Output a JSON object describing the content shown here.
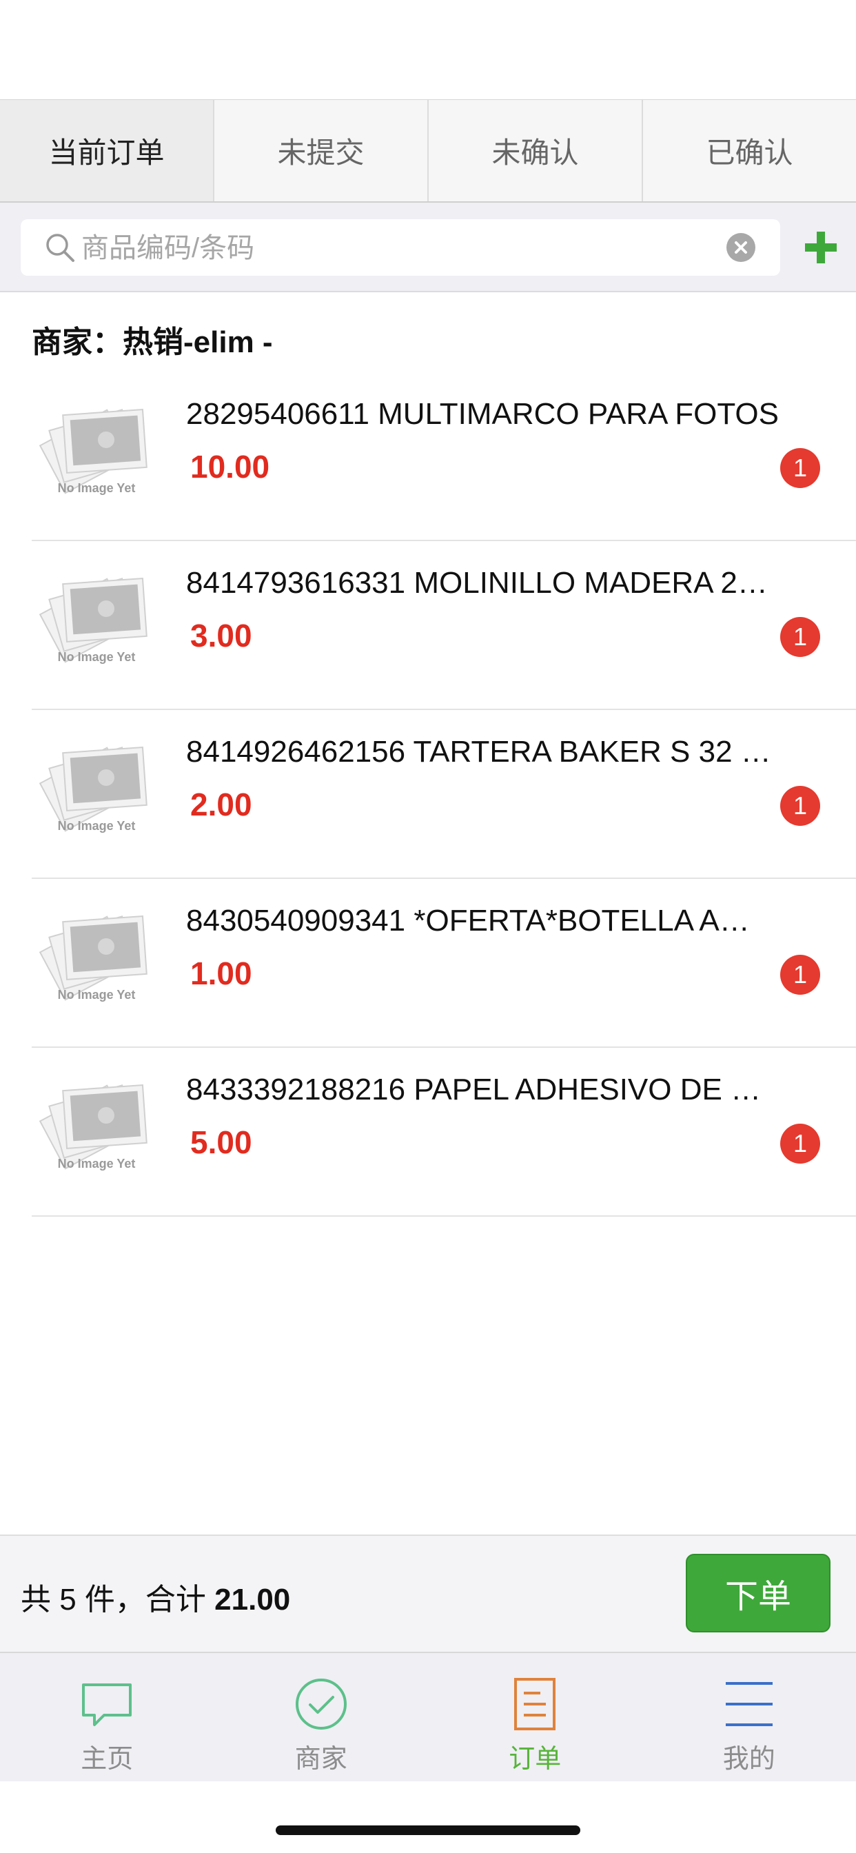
{
  "tabs": [
    {
      "label": "当前订单",
      "active": true
    },
    {
      "label": "未提交",
      "active": false
    },
    {
      "label": "未确认",
      "active": false
    },
    {
      "label": "已确认",
      "active": false
    }
  ],
  "search": {
    "placeholder": "商品编码/条码",
    "value": ""
  },
  "merchant": {
    "label": "商家：热销-elim -"
  },
  "items": [
    {
      "name": "28295406611 MULTIMARCO PARA FOTOS",
      "price": "10.00",
      "qty": "1",
      "thumb_text": "No Image Yet"
    },
    {
      "name": "8414793616331 MOLINILLO MADERA 2…",
      "price": "3.00",
      "qty": "1",
      "thumb_text": "No Image Yet"
    },
    {
      "name": "8414926462156 TARTERA BAKER S 32 …",
      "price": "2.00",
      "qty": "1",
      "thumb_text": "No Image Yet"
    },
    {
      "name": "8430540909341 *OFERTA*BOTELLA A…",
      "price": "1.00",
      "qty": "1",
      "thumb_text": "No Image Yet"
    },
    {
      "name": "8433392188216 PAPEL ADHESIVO DE …",
      "price": "5.00",
      "qty": "1",
      "thumb_text": "No Image Yet"
    }
  ],
  "summary": {
    "prefix": "共 5 件，合计 ",
    "total": "21.00",
    "submit_label": "下单"
  },
  "nav": [
    {
      "label": "主页",
      "icon": "chat-bubble-icon",
      "active": false
    },
    {
      "label": "商家",
      "icon": "check-circle-icon",
      "active": false
    },
    {
      "label": "订单",
      "icon": "document-icon",
      "active": true
    },
    {
      "label": "我的",
      "icon": "menu-lines-icon",
      "active": false
    }
  ],
  "colors": {
    "accent_green": "#3fa83a",
    "price_red": "#e12b1f",
    "badge_red": "#e53a2f"
  }
}
